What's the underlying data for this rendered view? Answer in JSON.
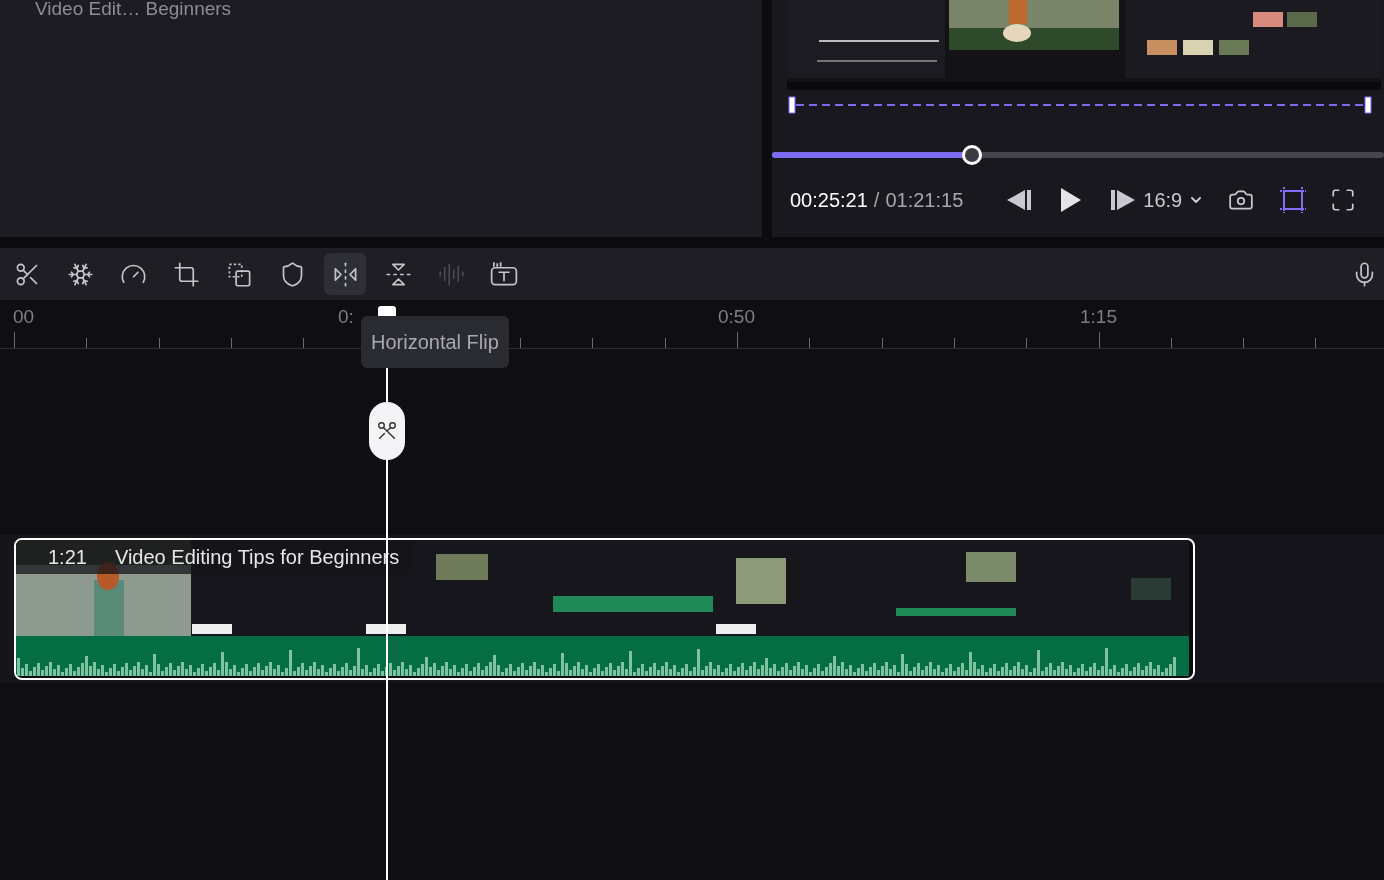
{
  "project": {
    "title": "Video Edit… Beginners"
  },
  "player": {
    "progress": {
      "level": 0.327
    },
    "current_time": "00:25:21",
    "separator": "/",
    "total_time": "01:21:15",
    "aspect_ratio": "16:9"
  },
  "toolbar": {
    "tools": [
      {
        "kind": "split",
        "selected": false,
        "disabled": false
      },
      {
        "kind": "freeze",
        "selected": false,
        "disabled": false
      },
      {
        "kind": "speed",
        "selected": false,
        "disabled": false
      },
      {
        "kind": "crop",
        "selected": false,
        "disabled": false
      },
      {
        "kind": "replace",
        "selected": false,
        "disabled": false
      },
      {
        "kind": "mark",
        "selected": false,
        "disabled": false
      },
      {
        "kind": "flip_horizontal",
        "selected": true,
        "disabled": false
      },
      {
        "kind": "flip_vertical",
        "selected": false,
        "disabled": false
      },
      {
        "kind": "voice",
        "selected": false,
        "disabled": true
      },
      {
        "kind": "text",
        "selected": false,
        "disabled": false
      }
    ]
  },
  "tooltip": "Horizontal Flip",
  "ruler": {
    "labels": [
      "00",
      "0:",
      "0:50",
      "1:15"
    ]
  },
  "clip": {
    "duration": "1:21",
    "title": "Video Editing Tips for Beginners",
    "selected": true
  }
}
